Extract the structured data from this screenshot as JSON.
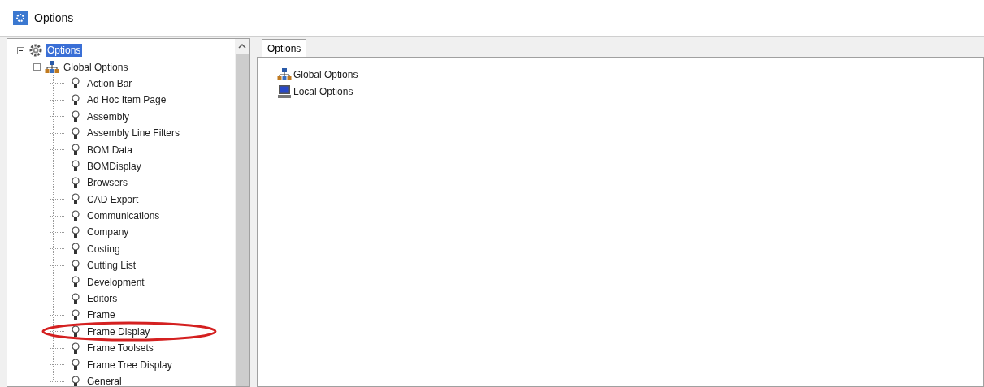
{
  "window": {
    "title": "Options"
  },
  "tree": [
    {
      "label": "Options",
      "kind": "gear",
      "selected": true,
      "expanded": true,
      "children": [
        {
          "label": "Global Options",
          "kind": "network",
          "selected": false,
          "expanded": true,
          "children": [
            {
              "label": "Action Bar",
              "kind": "bulb",
              "selected": false
            },
            {
              "label": "Ad Hoc Item Page",
              "kind": "bulb",
              "selected": false
            },
            {
              "label": "Assembly",
              "kind": "bulb",
              "selected": false
            },
            {
              "label": "Assembly Line Filters",
              "kind": "bulb",
              "selected": false
            },
            {
              "label": "BOM Data",
              "kind": "bulb",
              "selected": false
            },
            {
              "label": "BOMDisplay",
              "kind": "bulb",
              "selected": false
            },
            {
              "label": "Browsers",
              "kind": "bulb",
              "selected": false
            },
            {
              "label": "CAD Export",
              "kind": "bulb",
              "selected": false
            },
            {
              "label": "Communications",
              "kind": "bulb",
              "selected": false
            },
            {
              "label": "Company",
              "kind": "bulb",
              "selected": false
            },
            {
              "label": "Costing",
              "kind": "bulb",
              "selected": false
            },
            {
              "label": "Cutting List",
              "kind": "bulb",
              "selected": false
            },
            {
              "label": "Development",
              "kind": "bulb",
              "selected": false
            },
            {
              "label": "Editors",
              "kind": "bulb",
              "selected": false
            },
            {
              "label": "Frame",
              "kind": "bulb",
              "selected": false
            },
            {
              "label": "Frame Display",
              "kind": "bulb",
              "selected": false
            },
            {
              "label": "Frame Toolsets",
              "kind": "bulb",
              "selected": false
            },
            {
              "label": "Frame Tree Display",
              "kind": "bulb",
              "selected": false
            },
            {
              "label": "General",
              "kind": "bulb",
              "selected": false
            }
          ]
        }
      ]
    }
  ],
  "tab": {
    "label": "Options",
    "selected": true
  },
  "list": [
    {
      "label": "Global Options",
      "kind": "network"
    },
    {
      "label": "Local Options",
      "kind": "computer"
    }
  ]
}
